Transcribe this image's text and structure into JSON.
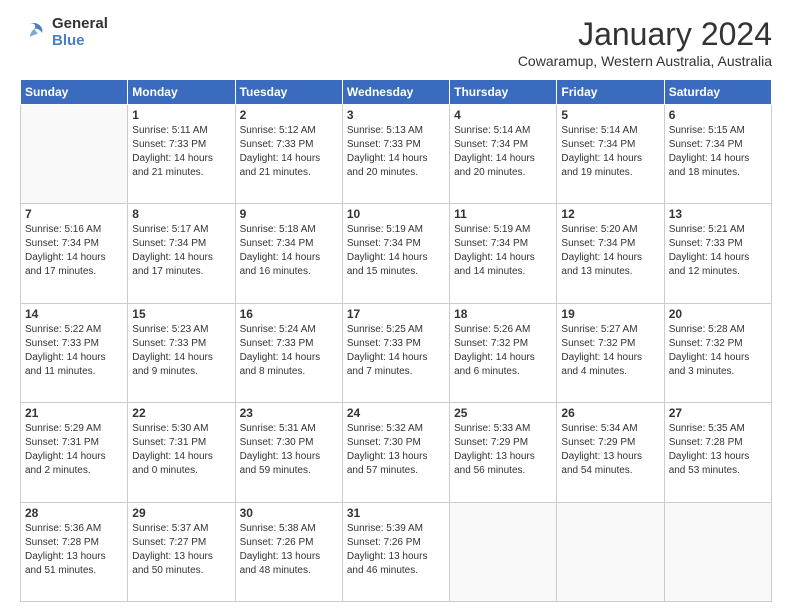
{
  "logo": {
    "general": "General",
    "blue": "Blue"
  },
  "header": {
    "title": "January 2024",
    "subtitle": "Cowaramup, Western Australia, Australia"
  },
  "columns": [
    "Sunday",
    "Monday",
    "Tuesday",
    "Wednesday",
    "Thursday",
    "Friday",
    "Saturday"
  ],
  "weeks": [
    [
      {
        "day": "",
        "info": ""
      },
      {
        "day": "1",
        "info": "Sunrise: 5:11 AM\nSunset: 7:33 PM\nDaylight: 14 hours\nand 21 minutes."
      },
      {
        "day": "2",
        "info": "Sunrise: 5:12 AM\nSunset: 7:33 PM\nDaylight: 14 hours\nand 21 minutes."
      },
      {
        "day": "3",
        "info": "Sunrise: 5:13 AM\nSunset: 7:33 PM\nDaylight: 14 hours\nand 20 minutes."
      },
      {
        "day": "4",
        "info": "Sunrise: 5:14 AM\nSunset: 7:34 PM\nDaylight: 14 hours\nand 20 minutes."
      },
      {
        "day": "5",
        "info": "Sunrise: 5:14 AM\nSunset: 7:34 PM\nDaylight: 14 hours\nand 19 minutes."
      },
      {
        "day": "6",
        "info": "Sunrise: 5:15 AM\nSunset: 7:34 PM\nDaylight: 14 hours\nand 18 minutes."
      }
    ],
    [
      {
        "day": "7",
        "info": "Sunrise: 5:16 AM\nSunset: 7:34 PM\nDaylight: 14 hours\nand 17 minutes."
      },
      {
        "day": "8",
        "info": "Sunrise: 5:17 AM\nSunset: 7:34 PM\nDaylight: 14 hours\nand 17 minutes."
      },
      {
        "day": "9",
        "info": "Sunrise: 5:18 AM\nSunset: 7:34 PM\nDaylight: 14 hours\nand 16 minutes."
      },
      {
        "day": "10",
        "info": "Sunrise: 5:19 AM\nSunset: 7:34 PM\nDaylight: 14 hours\nand 15 minutes."
      },
      {
        "day": "11",
        "info": "Sunrise: 5:19 AM\nSunset: 7:34 PM\nDaylight: 14 hours\nand 14 minutes."
      },
      {
        "day": "12",
        "info": "Sunrise: 5:20 AM\nSunset: 7:34 PM\nDaylight: 14 hours\nand 13 minutes."
      },
      {
        "day": "13",
        "info": "Sunrise: 5:21 AM\nSunset: 7:33 PM\nDaylight: 14 hours\nand 12 minutes."
      }
    ],
    [
      {
        "day": "14",
        "info": "Sunrise: 5:22 AM\nSunset: 7:33 PM\nDaylight: 14 hours\nand 11 minutes."
      },
      {
        "day": "15",
        "info": "Sunrise: 5:23 AM\nSunset: 7:33 PM\nDaylight: 14 hours\nand 9 minutes."
      },
      {
        "day": "16",
        "info": "Sunrise: 5:24 AM\nSunset: 7:33 PM\nDaylight: 14 hours\nand 8 minutes."
      },
      {
        "day": "17",
        "info": "Sunrise: 5:25 AM\nSunset: 7:33 PM\nDaylight: 14 hours\nand 7 minutes."
      },
      {
        "day": "18",
        "info": "Sunrise: 5:26 AM\nSunset: 7:32 PM\nDaylight: 14 hours\nand 6 minutes."
      },
      {
        "day": "19",
        "info": "Sunrise: 5:27 AM\nSunset: 7:32 PM\nDaylight: 14 hours\nand 4 minutes."
      },
      {
        "day": "20",
        "info": "Sunrise: 5:28 AM\nSunset: 7:32 PM\nDaylight: 14 hours\nand 3 minutes."
      }
    ],
    [
      {
        "day": "21",
        "info": "Sunrise: 5:29 AM\nSunset: 7:31 PM\nDaylight: 14 hours\nand 2 minutes."
      },
      {
        "day": "22",
        "info": "Sunrise: 5:30 AM\nSunset: 7:31 PM\nDaylight: 14 hours\nand 0 minutes."
      },
      {
        "day": "23",
        "info": "Sunrise: 5:31 AM\nSunset: 7:30 PM\nDaylight: 13 hours\nand 59 minutes."
      },
      {
        "day": "24",
        "info": "Sunrise: 5:32 AM\nSunset: 7:30 PM\nDaylight: 13 hours\nand 57 minutes."
      },
      {
        "day": "25",
        "info": "Sunrise: 5:33 AM\nSunset: 7:29 PM\nDaylight: 13 hours\nand 56 minutes."
      },
      {
        "day": "26",
        "info": "Sunrise: 5:34 AM\nSunset: 7:29 PM\nDaylight: 13 hours\nand 54 minutes."
      },
      {
        "day": "27",
        "info": "Sunrise: 5:35 AM\nSunset: 7:28 PM\nDaylight: 13 hours\nand 53 minutes."
      }
    ],
    [
      {
        "day": "28",
        "info": "Sunrise: 5:36 AM\nSunset: 7:28 PM\nDaylight: 13 hours\nand 51 minutes."
      },
      {
        "day": "29",
        "info": "Sunrise: 5:37 AM\nSunset: 7:27 PM\nDaylight: 13 hours\nand 50 minutes."
      },
      {
        "day": "30",
        "info": "Sunrise: 5:38 AM\nSunset: 7:26 PM\nDaylight: 13 hours\nand 48 minutes."
      },
      {
        "day": "31",
        "info": "Sunrise: 5:39 AM\nSunset: 7:26 PM\nDaylight: 13 hours\nand 46 minutes."
      },
      {
        "day": "",
        "info": ""
      },
      {
        "day": "",
        "info": ""
      },
      {
        "day": "",
        "info": ""
      }
    ]
  ]
}
